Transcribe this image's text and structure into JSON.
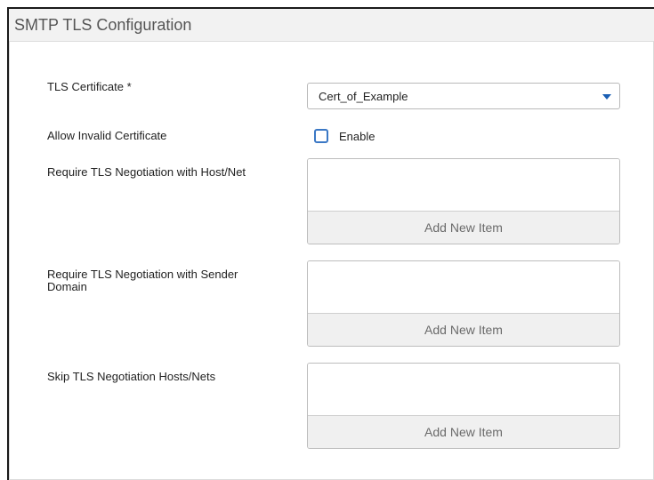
{
  "panel": {
    "title": "SMTP TLS Configuration"
  },
  "fields": {
    "tls_certificate": {
      "label": "TLS Certificate *",
      "value": "Cert_of_Example"
    },
    "allow_invalid": {
      "label": "Allow Invalid Certificate",
      "checkbox_label": "Enable",
      "checked": false
    },
    "require_host": {
      "label": "Require TLS Negotiation with Host/Net",
      "add_label": "Add New Item"
    },
    "require_sender": {
      "label_line1": "Require TLS Negotiation with Sender",
      "label_line2": "Domain",
      "add_label": "Add New Item"
    },
    "skip_hosts": {
      "label": "Skip TLS Negotiation Hosts/Nets",
      "add_label": "Add New Item"
    }
  },
  "colors": {
    "accent": "#1a5fb4",
    "checkbox_border": "#3b78c5"
  },
  "icons": {
    "dropdown": "chevron-down-icon"
  }
}
